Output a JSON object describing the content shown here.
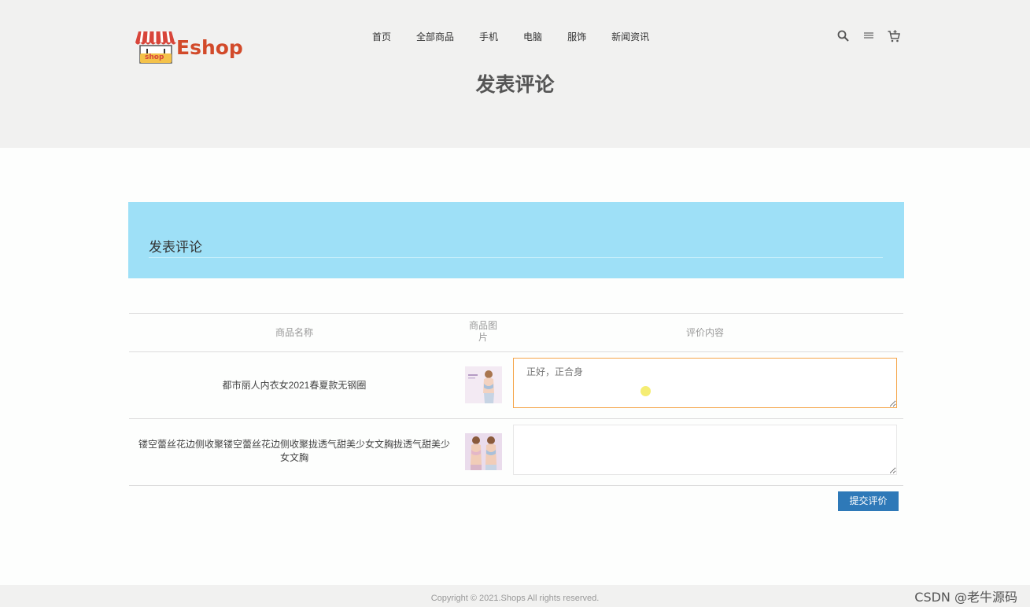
{
  "header": {
    "logo_text": "Eshop",
    "logo_badge": "shop",
    "nav": [
      "首页",
      "全部商品",
      "手机",
      "电脑",
      "服饰",
      "新闻资讯"
    ],
    "icons": [
      "search-icon",
      "menu-icon",
      "cart-icon"
    ]
  },
  "page_title": "发表评论",
  "banner": {
    "title": "发表评论",
    "color": "#9ee0f7"
  },
  "table": {
    "headers": {
      "name": "商品名称",
      "image": "商品图片",
      "content": "评价内容"
    },
    "rows": [
      {
        "name": "都市丽人内衣女2021春夏款无钢圈",
        "review": "正好，正合身"
      },
      {
        "name": "镂空蕾丝花边侧收聚镂空蕾丝花边侧收聚拢透气甜美少女文胸拢透气甜美少女文胸",
        "review": ""
      }
    ]
  },
  "submit_label": "提交评价",
  "footer": {
    "copyright": "Copyright © 2021.Shops All rights reserved.",
    "watermark": "CSDN @老牛源码"
  },
  "colors": {
    "accent": "#2e79b8",
    "focus_border": "#f5a64a",
    "header_bg": "#f1f1f0"
  }
}
